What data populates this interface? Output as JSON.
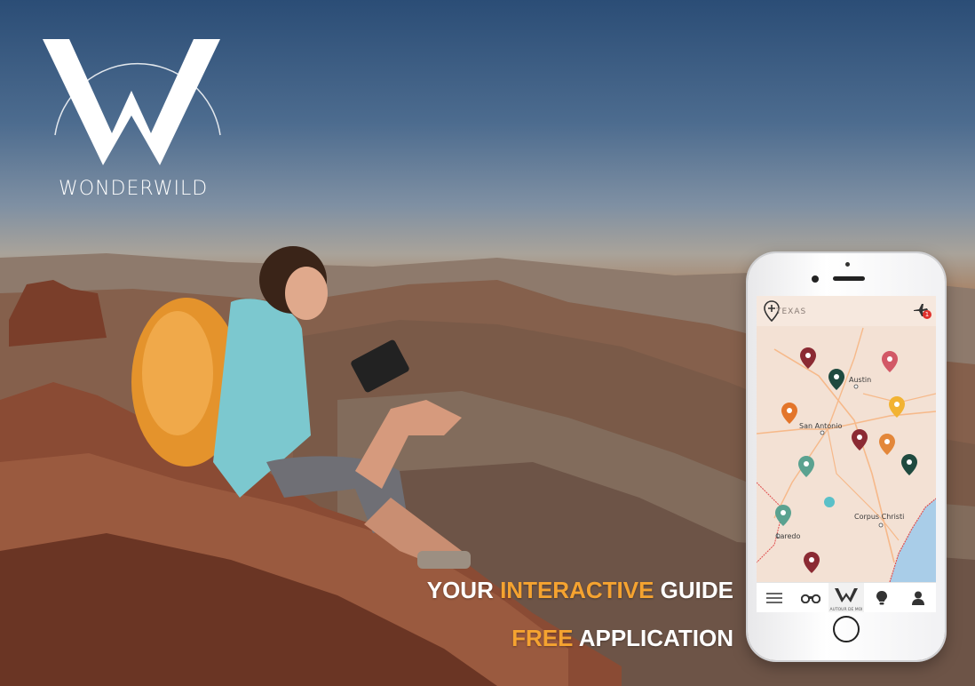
{
  "brand": {
    "name": "WONDERWILD"
  },
  "taglines": {
    "line1_part1": "YOUR ",
    "line1_accent": "INTERACTIVE",
    "line1_part2": " GUIDE",
    "line2_accent": "FREE",
    "line2_part": " APPLICATION"
  },
  "colors": {
    "accent": "#f5a330",
    "text": "#ffffff",
    "badge": "#e0302c"
  },
  "app": {
    "header": {
      "location": "TEXAS",
      "notification_count": "1",
      "left_icon": "pin-plus-icon",
      "right_icon": "plane-icon"
    },
    "map": {
      "cities": {
        "austin": "Austin",
        "san_antonio": "San Antonio",
        "corpus_christi": "Corpus Christi",
        "laredo": "Laredo"
      },
      "pin_colors": [
        "#8b2a33",
        "#c94a5a",
        "#1f4a3f",
        "#e3752a",
        "#f2b333",
        "#5aa290",
        "#e3873a"
      ]
    },
    "tabs": [
      {
        "icon": "menu-icon",
        "label": ""
      },
      {
        "icon": "binoculars-icon",
        "label": ""
      },
      {
        "icon": "wonderwild-logo-icon",
        "label": "AUTOUR DE MOI"
      },
      {
        "icon": "lightbulb-icon",
        "label": ""
      },
      {
        "icon": "user-icon",
        "label": ""
      }
    ]
  }
}
